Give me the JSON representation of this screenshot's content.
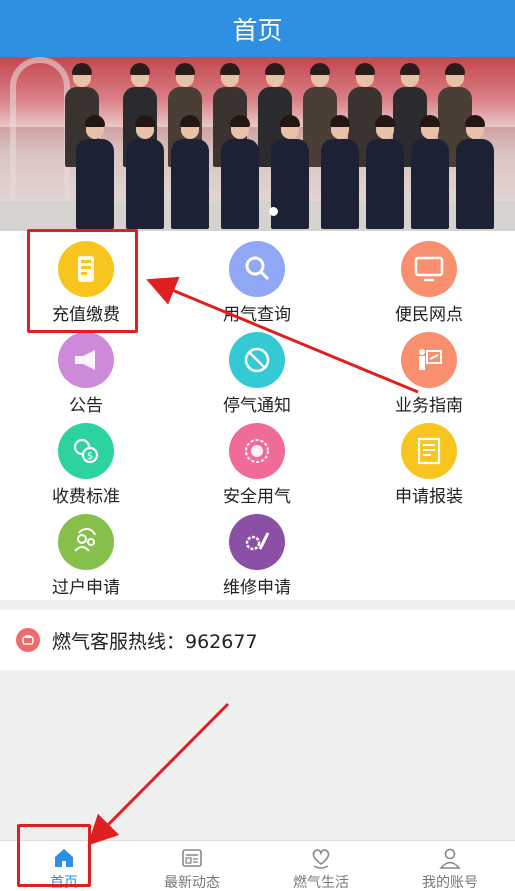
{
  "header": {
    "title": "首页"
  },
  "banner": {
    "image_desc": "staff group photo",
    "carousel_active": 1,
    "carousel_count": 1
  },
  "services": [
    {
      "label": "充值缴费",
      "icon": "phone-payment-icon",
      "color": "#f7c51e"
    },
    {
      "label": "用气查询",
      "icon": "magnifier-icon",
      "color": "#8fa7f5"
    },
    {
      "label": "便民网点",
      "icon": "monitor-icon",
      "color": "#f88f6f"
    },
    {
      "label": "公告",
      "icon": "megaphone-icon",
      "color": "#cc8ad8"
    },
    {
      "label": "停气通知",
      "icon": "gas-off-icon",
      "color": "#34c9d4"
    },
    {
      "label": "业务指南",
      "icon": "guide-board-icon",
      "color": "#f88f6f"
    },
    {
      "label": "收费标准",
      "icon": "coins-icon",
      "color": "#2cd3a0"
    },
    {
      "label": "安全用气",
      "icon": "safety-gear-icon",
      "color": "#f06b9a"
    },
    {
      "label": "申请报装",
      "icon": "document-icon",
      "color": "#f7c51e"
    },
    {
      "label": "过户申请",
      "icon": "transfer-users-icon",
      "color": "#86bf4a"
    },
    {
      "label": "维修申请",
      "icon": "wrench-gear-icon",
      "color": "#8b4fa6"
    }
  ],
  "hotline": {
    "text": "燃气客服热线：962677"
  },
  "tabbar": {
    "tabs": [
      {
        "label": "首页",
        "icon": "home-icon",
        "active": true
      },
      {
        "label": "最新动态",
        "icon": "news-icon",
        "active": false
      },
      {
        "label": "燃气生活",
        "icon": "heart-hand-icon",
        "active": false
      },
      {
        "label": "我的账号",
        "icon": "user-icon",
        "active": false
      }
    ]
  },
  "colors": {
    "brand": "#2f8fe0",
    "annotation": "#e02020"
  }
}
